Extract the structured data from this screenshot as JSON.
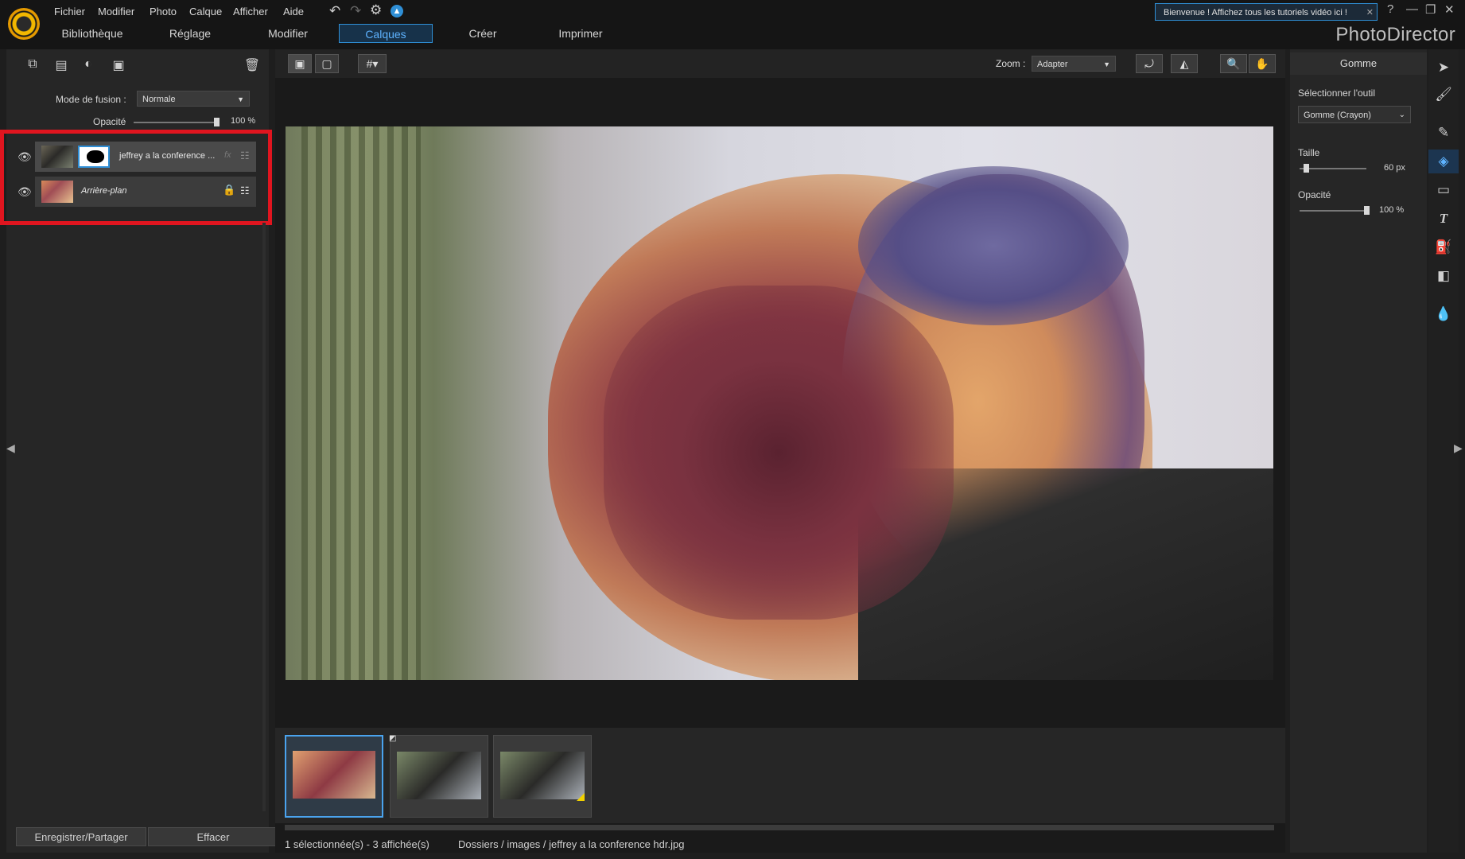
{
  "app": {
    "brand": "PhotoDirector",
    "welcome": "Bienvenue ! Affichez tous les tutoriels vidéo ici !",
    "help": "?"
  },
  "menu": [
    "Fichier",
    "Modifier",
    "Photo",
    "Calque",
    "Afficher",
    "Aide"
  ],
  "tabs": [
    {
      "label": "Bibliothèque"
    },
    {
      "label": "Réglage"
    },
    {
      "label": "Modifier"
    },
    {
      "label": "Calques",
      "active": true
    },
    {
      "label": "Créer"
    },
    {
      "label": "Imprimer"
    }
  ],
  "layers_panel": {
    "blend_label": "Mode de fusion :",
    "blend_value": "Normale",
    "opacity_label": "Opacité",
    "opacity_value": "100 %",
    "opacity": 1.0,
    "layers": [
      {
        "name": "jeffrey a la conference ...",
        "fx": "fx"
      },
      {
        "name": "Arrière-plan"
      }
    ],
    "save_button": "Enregistrer/Partager",
    "clear_button": "Effacer"
  },
  "canvas": {
    "zoom_label": "Zoom :",
    "zoom_value": "Adapter"
  },
  "status": {
    "selection": "1 sélectionnée(s) - 3 affichée(s)",
    "path": "Dossiers / images / jeffrey a la conference hdr.jpg"
  },
  "tool_panel": {
    "title": "Gomme",
    "select_label": "Sélectionner l'outil",
    "select_value": "Gomme (Crayon)",
    "size_label": "Taille",
    "size_value": "60 px",
    "size": 0.1,
    "opacity_label": "Opacité",
    "opacity_value": "100 %",
    "opacity": 1.0
  },
  "colors": {
    "accent": "#2f8fd6",
    "highlight_box": "#e0151f",
    "panel": "#262626"
  }
}
